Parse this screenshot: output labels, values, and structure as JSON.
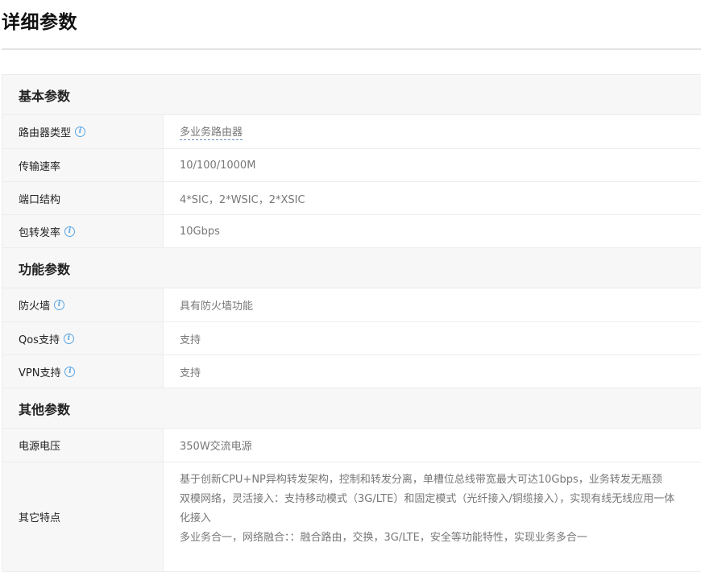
{
  "page": {
    "title": "详细参数"
  },
  "sections": [
    {
      "title": "基本参数",
      "rows": [
        {
          "label": "路由器类型",
          "value": "多业务路由器",
          "has_info": true,
          "value_link": true
        },
        {
          "label": "传输速率",
          "value": "10/100/1000M",
          "has_info": false
        },
        {
          "label": "端口结构",
          "value": "4*SIC，2*WSIC，2*XSIC",
          "has_info": false
        },
        {
          "label": "包转发率",
          "value": "10Gbps",
          "has_info": true
        }
      ]
    },
    {
      "title": "功能参数",
      "rows": [
        {
          "label": "防火墙",
          "value": "具有防火墙功能",
          "has_info": true
        },
        {
          "label": "Qos支持",
          "value": "支持",
          "has_info": true
        },
        {
          "label": "VPN支持",
          "value": "支持",
          "has_info": true
        }
      ]
    },
    {
      "title": "其他参数",
      "rows": [
        {
          "label": "电源电压",
          "value": "350W交流电源",
          "has_info": false
        },
        {
          "label": "其它特点",
          "paragraphs": [
            "基于创新CPU+NP异构转发架构，控制和转发分离，单槽位总线带宽最大可达10Gbps，业务转发无瓶颈",
            "双模网络，灵活接入：支持移动模式（3G/LTE）和固定模式（光纤接入/铜缆接入），实现有线无线应用一体化接入",
            "多业务合一，网络融合：：融合路由，交换，3G/LTE，安全等功能特性，实现业务多合一"
          ]
        }
      ]
    }
  ],
  "icons": {
    "info": "info-circle-icon",
    "info_glyph": "i",
    "info_color": "#5aa6e6"
  }
}
